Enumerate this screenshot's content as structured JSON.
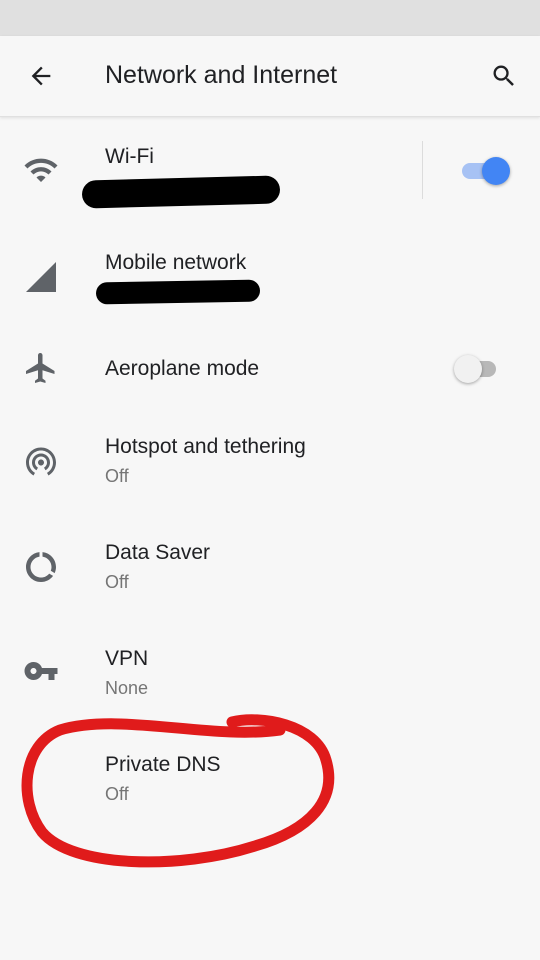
{
  "header": {
    "title": "Network and Internet",
    "back_icon": "back-arrow-icon",
    "search_icon": "search-icon"
  },
  "items": [
    {
      "label": "Wi-Fi",
      "subtitle": "",
      "icon": "wifi-icon",
      "toggle": "on"
    },
    {
      "label": "Mobile network",
      "subtitle": "",
      "icon": "signal-icon"
    },
    {
      "label": "Aeroplane mode",
      "icon": "airplane-icon",
      "toggle": "off"
    },
    {
      "label": "Hotspot and tethering",
      "subtitle": "Off",
      "icon": "hotspot-icon"
    },
    {
      "label": "Data Saver",
      "subtitle": "Off",
      "icon": "data-saver-icon"
    },
    {
      "label": "VPN",
      "subtitle": "None",
      "icon": "vpn-key-icon"
    },
    {
      "label": "Private DNS",
      "subtitle": "Off"
    }
  ],
  "colors": {
    "accent": "#4285f4",
    "annotation": "#e01b1b",
    "icon": "#5f6368"
  }
}
